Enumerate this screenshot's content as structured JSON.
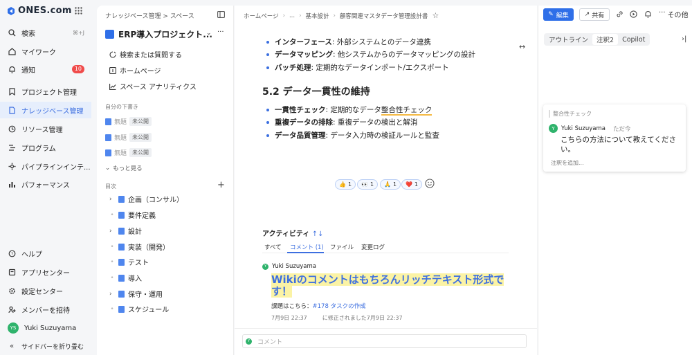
{
  "brand": {
    "name": "ONES.com"
  },
  "nav": {
    "items": [
      {
        "label": "検索",
        "shortcut": "⌘+J"
      },
      {
        "label": "マイワーク"
      },
      {
        "label": "通知",
        "badge": "10"
      },
      {
        "label": "プロジェクト管理"
      },
      {
        "label": "ナレッジベース管理",
        "active": true
      },
      {
        "label": "リソース管理"
      },
      {
        "label": "プログラム"
      },
      {
        "label": "パイプラインインテ..."
      },
      {
        "label": "パフォーマンス"
      }
    ],
    "bottom": [
      {
        "label": "ヘルプ"
      },
      {
        "label": "アプリセンター"
      },
      {
        "label": "設定センター"
      },
      {
        "label": "メンバーを招待"
      },
      {
        "label": "Yuki Suzuyama",
        "avatar": "YS"
      },
      {
        "label": "サイドバーを折り畳む"
      }
    ]
  },
  "panel": {
    "breadcrumb": "ナレッジベース管理 > スペース",
    "space_title": "ERP導入プロジェクト...",
    "items": [
      {
        "label": "検索または質問する"
      },
      {
        "label": "ホームページ"
      },
      {
        "label": "スペース アナリティクス"
      }
    ],
    "drafts_label": "自分の下書き",
    "drafts": [
      {
        "title": "無題",
        "status": "未公開"
      },
      {
        "title": "無題",
        "status": "未公開"
      },
      {
        "title": "無題",
        "status": "未公開"
      }
    ],
    "more_label": "もっと見る",
    "toc_label": "目次",
    "toc": [
      {
        "label": "企画（コンサル）",
        "expandable": true
      },
      {
        "label": "要件定義",
        "expandable": false
      },
      {
        "label": "設計",
        "expandable": true
      },
      {
        "label": "実装（開発）",
        "expandable": false
      },
      {
        "label": "テスト",
        "expandable": false
      },
      {
        "label": "導入",
        "expandable": false
      },
      {
        "label": "保守・運用",
        "expandable": true
      },
      {
        "label": "スケジュール",
        "expandable": false
      }
    ]
  },
  "main": {
    "breadcrumb": [
      "ホームページ",
      "...",
      "基本設計",
      "顧客関連マスタデータ管理設計書"
    ],
    "bullets_top": [
      {
        "bold": "インターフェース",
        "text": ": 外部システムとのデータ連携"
      },
      {
        "bold": "データマッピング",
        "text": ": 他システムからのデータマッピングの設計"
      },
      {
        "bold": "バッチ処理",
        "text": ": 定期的なデータインポート/エクスポート"
      }
    ],
    "section_title": "5.2 データ一貫性の維持",
    "bullets_bottom": [
      {
        "bold": "一貫性チェック",
        "text_before": ": 定期的なデータ",
        "highlight": "整合性チェック",
        "text": ""
      },
      {
        "bold": "重複データの排除",
        "text_before": ": 重複データの検出と解消",
        "highlight": "",
        "text": ""
      },
      {
        "bold": "データ品質管理",
        "text_before": ": データ入力時の検証ルールと監査",
        "highlight": "",
        "text": ""
      }
    ],
    "reactions": [
      {
        "emoji": "👍",
        "count": "1"
      },
      {
        "emoji": "👀",
        "count": "1"
      },
      {
        "emoji": "🙏",
        "count": "1"
      },
      {
        "emoji": "❤️",
        "count": "1"
      }
    ],
    "activity_title": "アクティビティ",
    "activity_sort": "↑↓",
    "tabs": [
      "すべて",
      "コメント (1)",
      "ファイル",
      "変更ログ"
    ],
    "comment": {
      "author": "Yuki Suzuyama",
      "avatar": "Y",
      "rich_text": "Wikiのコメントはもちろんリッチテキスト形式です！",
      "link_prefix": "課題はこちら：",
      "link_text": "#178 タスクの作成",
      "date": "7月9日 22:37",
      "edited": "に修正されました7月9日 22:37"
    },
    "comment_placeholder": "コメント"
  },
  "toolbar": {
    "edit_label": "編集",
    "share_label": "共有",
    "more_label": "その他"
  },
  "right": {
    "tabs": [
      "アウトライン",
      "注釈2",
      "Copilot"
    ],
    "annotation": {
      "quote": "整合性チェック",
      "user": "Yuki Suzuyama",
      "avatar": "Y",
      "time": "ただ今",
      "text": "こちらの方法について教えてください。",
      "add_label": "注釈を追加..."
    }
  }
}
